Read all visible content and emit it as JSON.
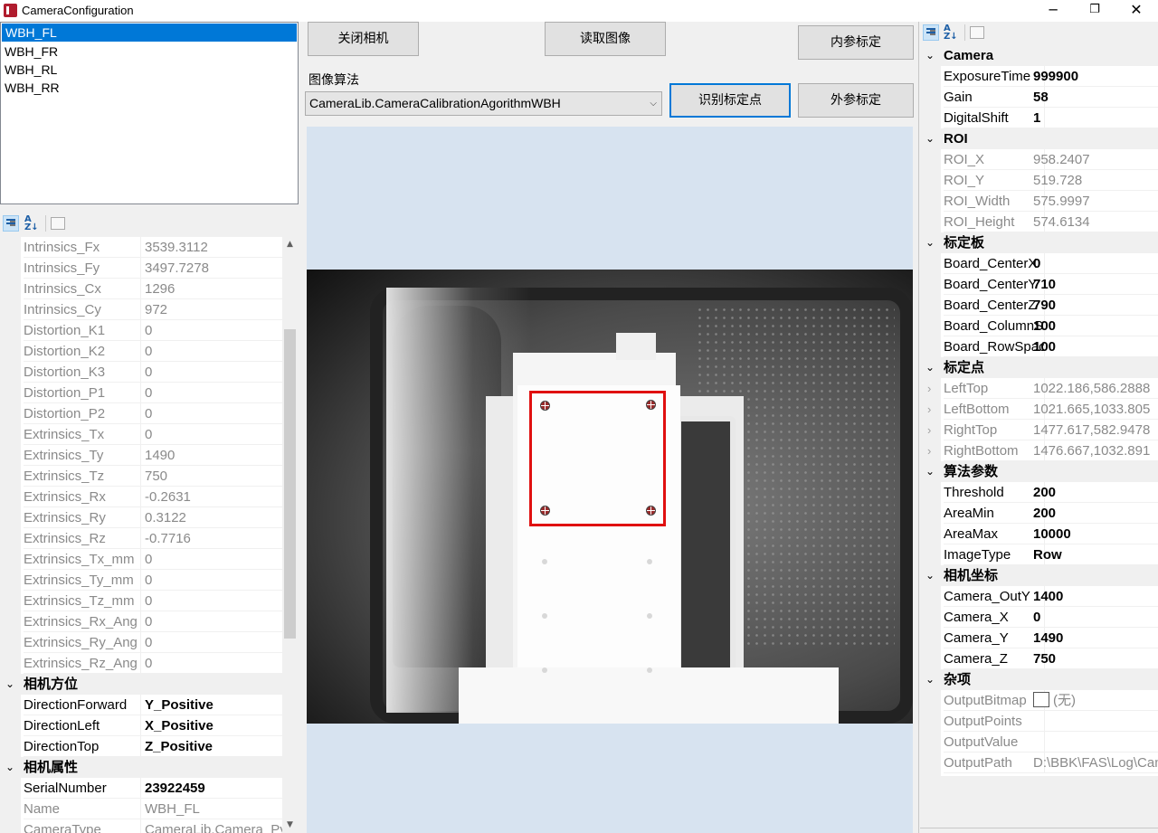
{
  "window": {
    "title": "CameraConfiguration",
    "minimize": "─",
    "maximize": "❐",
    "close": "✕"
  },
  "cameras": [
    "WBH_FL",
    "WBH_FR",
    "WBH_RL",
    "WBH_RR"
  ],
  "selected_camera_index": 0,
  "toolbar": {
    "close_camera": "关闭相机",
    "read_image": "读取图像",
    "intrinsic_calib": "内参标定",
    "detect_points": "识别标定点",
    "extrinsic_calib": "外参标定",
    "algo_label": "图像算法",
    "algo_value": "CameraLib.CameraCalibrationAgorithmWBH",
    "sort_az_icon": "A-Z sort icon",
    "categorized_icon": "categorized view icon",
    "property_pages_icon": "property pages icon"
  },
  "left_grid": {
    "rows": [
      {
        "n": "Intrinsics_Fx",
        "v": "3539.3112",
        "ro": true
      },
      {
        "n": "Intrinsics_Fy",
        "v": "3497.7278",
        "ro": true
      },
      {
        "n": "Intrinsics_Cx",
        "v": "1296",
        "ro": true
      },
      {
        "n": "Intrinsics_Cy",
        "v": "972",
        "ro": true
      },
      {
        "n": "Distortion_K1",
        "v": "0",
        "ro": true
      },
      {
        "n": "Distortion_K2",
        "v": "0",
        "ro": true
      },
      {
        "n": "Distortion_K3",
        "v": "0",
        "ro": true
      },
      {
        "n": "Distortion_P1",
        "v": "0",
        "ro": true
      },
      {
        "n": "Distortion_P2",
        "v": "0",
        "ro": true
      },
      {
        "n": "Extrinsics_Tx",
        "v": "0",
        "ro": true
      },
      {
        "n": "Extrinsics_Ty",
        "v": "1490",
        "ro": true
      },
      {
        "n": "Extrinsics_Tz",
        "v": "750",
        "ro": true
      },
      {
        "n": "Extrinsics_Rx",
        "v": "-0.2631",
        "ro": true
      },
      {
        "n": "Extrinsics_Ry",
        "v": "0.3122",
        "ro": true
      },
      {
        "n": "Extrinsics_Rz",
        "v": "-0.7716",
        "ro": true
      },
      {
        "n": "Extrinsics_Tx_mm",
        "v": "0",
        "ro": true
      },
      {
        "n": "Extrinsics_Ty_mm",
        "v": "0",
        "ro": true
      },
      {
        "n": "Extrinsics_Tz_mm",
        "v": "0",
        "ro": true
      },
      {
        "n": "Extrinsics_Rx_Ang",
        "v": "0",
        "ro": true
      },
      {
        "n": "Extrinsics_Ry_Ang",
        "v": "0",
        "ro": true
      },
      {
        "n": "Extrinsics_Rz_Ang",
        "v": "0",
        "ro": true
      },
      {
        "cat": "相机方位"
      },
      {
        "n": "DirectionForward",
        "v": "Y_Positive",
        "bold": true
      },
      {
        "n": "DirectionLeft",
        "v": "X_Positive",
        "bold": true
      },
      {
        "n": "DirectionTop",
        "v": "Z_Positive",
        "bold": true
      },
      {
        "cat": "相机属性"
      },
      {
        "n": "SerialNumber",
        "v": "23922459",
        "bold": true
      },
      {
        "n": "Name",
        "v": "WBH_FL",
        "ro": true
      },
      {
        "n": "CameraType",
        "v": "CameraLib.Camera_Pyl",
        "ro": true
      }
    ]
  },
  "right_grid": {
    "rows": [
      {
        "cat": "Camera"
      },
      {
        "n": "ExposureTime",
        "v": "999900",
        "bold": true
      },
      {
        "n": "Gain",
        "v": "58",
        "bold": true
      },
      {
        "n": "DigitalShift",
        "v": "1",
        "bold": true
      },
      {
        "cat": "ROI"
      },
      {
        "n": "ROI_X",
        "v": "958.2407",
        "ro": true
      },
      {
        "n": "ROI_Y",
        "v": "519.728",
        "ro": true
      },
      {
        "n": "ROI_Width",
        "v": "575.9997",
        "ro": true
      },
      {
        "n": "ROI_Height",
        "v": "574.6134",
        "ro": true
      },
      {
        "cat": "标定板"
      },
      {
        "n": "Board_CenterX",
        "v": "0",
        "bold": true
      },
      {
        "n": "Board_CenterY",
        "v": "710",
        "bold": true
      },
      {
        "n": "Board_CenterZ",
        "v": "790",
        "bold": true
      },
      {
        "n": "Board_ColumnSpace",
        "v": "100",
        "bold": true
      },
      {
        "n": "Board_RowSpace",
        "v": "100",
        "bold": true
      },
      {
        "cat": "标定点"
      },
      {
        "n": "LeftTop",
        "v": "1022.186,586.2888",
        "ro": true,
        "exp": true
      },
      {
        "n": "LeftBottom",
        "v": "1021.665,1033.805",
        "ro": true,
        "exp": true
      },
      {
        "n": "RightTop",
        "v": "1477.617,582.9478",
        "ro": true,
        "exp": true
      },
      {
        "n": "RightBottom",
        "v": "1476.667,1032.891",
        "ro": true,
        "exp": true
      },
      {
        "cat": "算法参数"
      },
      {
        "n": "Threshold",
        "v": "200",
        "bold": true
      },
      {
        "n": "AreaMin",
        "v": "200",
        "bold": true
      },
      {
        "n": "AreaMax",
        "v": "10000",
        "bold": true
      },
      {
        "n": "ImageType",
        "v": "Row",
        "bold": true
      },
      {
        "cat": "相机坐标"
      },
      {
        "n": "Camera_OutY",
        "v": "1400",
        "bold": true
      },
      {
        "n": "Camera_X",
        "v": "0",
        "bold": true
      },
      {
        "n": "Camera_Y",
        "v": "1490",
        "bold": true
      },
      {
        "n": "Camera_Z",
        "v": "750",
        "bold": true
      },
      {
        "cat": "杂项"
      },
      {
        "n": "OutputBitmap",
        "v": "(无)",
        "ro": true,
        "check": true
      },
      {
        "n": "OutputPoints",
        "v": "",
        "ro": true
      },
      {
        "n": "OutputValue",
        "v": "",
        "ro": true
      },
      {
        "n": "OutputPath",
        "v": "D:\\BBK\\FAS\\Log\\Cam",
        "ro": true
      }
    ]
  },
  "colors": {
    "selection": "#0078d7",
    "roi_box": "#e01010",
    "canvas_bg": "#d7e3f0"
  }
}
